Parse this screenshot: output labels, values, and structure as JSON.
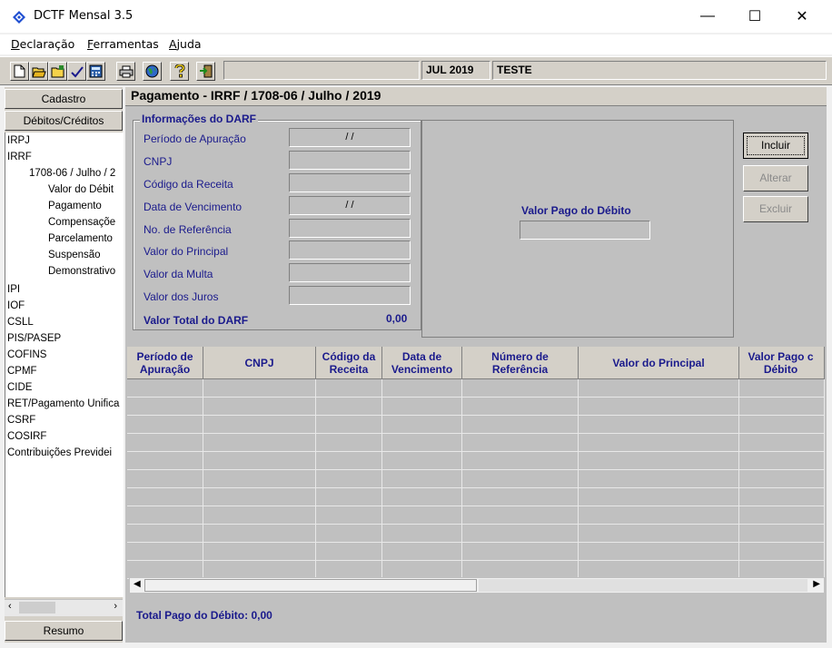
{
  "window": {
    "title": "DCTF Mensal 3.5",
    "minimize": "—",
    "maximize": "☐",
    "close": "✕"
  },
  "menu": {
    "items": [
      {
        "first": "D",
        "rest": "eclaração"
      },
      {
        "first": "F",
        "rest": "erramentas"
      },
      {
        "first": "A",
        "rest": "juda"
      }
    ]
  },
  "toolbar": {
    "icons": [
      "new-icon",
      "open-icon",
      "folder-icon",
      "check-icon",
      "calculator-icon",
      "print-icon",
      "globe-icon",
      "help-icon",
      "exit-icon"
    ],
    "status_empty": "",
    "period": "JUL 2019",
    "company": "TESTE"
  },
  "left_panel": {
    "cadastro": "Cadastro",
    "debitos_creditos": "Débitos/Créditos",
    "resumo": "Resumo",
    "tree": [
      {
        "label": "IRPJ",
        "level": 0
      },
      {
        "label": "IRRF",
        "level": 0
      },
      {
        "label": "1708-06 / Julho / 2",
        "level": 1
      },
      {
        "label": "Valor do Débit",
        "level": 2
      },
      {
        "label": "Pagamento",
        "level": 2
      },
      {
        "label": "Compensaçõe",
        "level": 2
      },
      {
        "label": "Parcelamento",
        "level": 2
      },
      {
        "label": "Suspensão",
        "level": 2
      },
      {
        "label": "Demonstrativo",
        "level": 2
      },
      {
        "label": "IPI",
        "level": 0
      },
      {
        "label": "IOF",
        "level": 0
      },
      {
        "label": "CSLL",
        "level": 0
      },
      {
        "label": "PIS/PASEP",
        "level": 0
      },
      {
        "label": "COFINS",
        "level": 0
      },
      {
        "label": "CPMF",
        "level": 0
      },
      {
        "label": "CIDE",
        "level": 0
      },
      {
        "label": "RET/Pagamento Unifica",
        "level": 0
      },
      {
        "label": "CSRF",
        "level": 0
      },
      {
        "label": "COSIRF",
        "level": 0
      },
      {
        "label": "Contribuições Previdei",
        "level": 0
      }
    ]
  },
  "main": {
    "heading": "Pagamento - IRRF / 1708-06 / Julho / 2019",
    "group_title": "Informações do DARF",
    "fields": [
      {
        "label": "Período de Apuração",
        "value": "/ /"
      },
      {
        "label": "CNPJ",
        "value": ""
      },
      {
        "label": "Código da Receita",
        "value": ""
      },
      {
        "label": "Data de Vencimento",
        "value": "/ /"
      },
      {
        "label": "No. de Referência",
        "value": ""
      },
      {
        "label": "Valor do Principal",
        "value": ""
      },
      {
        "label": "Valor da Multa",
        "value": ""
      },
      {
        "label": "Valor dos Juros",
        "value": ""
      }
    ],
    "total_label": "Valor Total do DARF",
    "total_value": "0,00",
    "valor_pago_label": "Valor Pago do Débito",
    "valor_pago_value": "",
    "buttons": {
      "incluir": "Incluir",
      "alterar": "Alterar",
      "excluir": "Excluir"
    },
    "columns": [
      "Período de Apuração",
      "CNPJ",
      "Código da Receita",
      "Data de Vencimento",
      "Número de Referência",
      "Valor do Principal",
      "Valor Pago c Débito"
    ],
    "footer_label": "Total Pago do Débito:",
    "footer_value": "0,00"
  }
}
